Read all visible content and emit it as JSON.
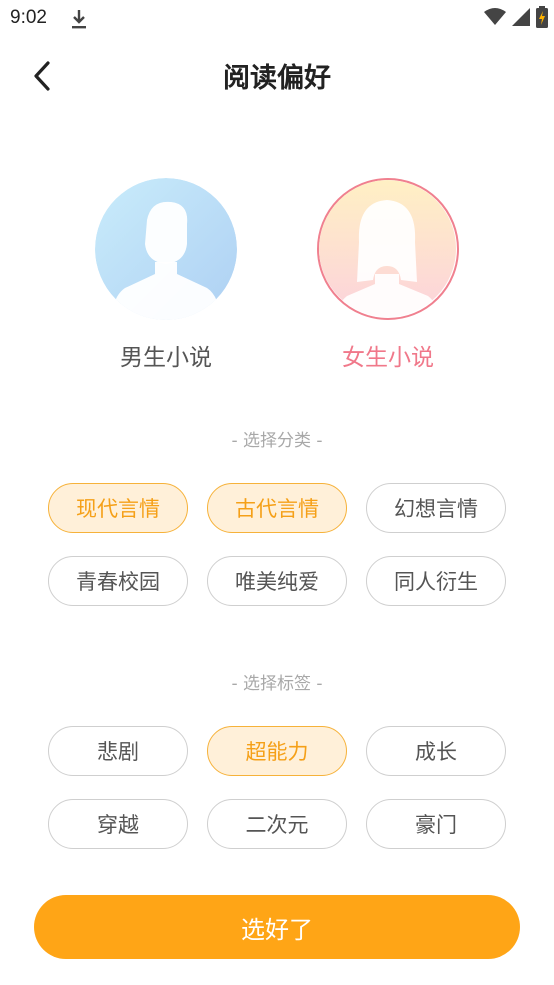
{
  "status_bar": {
    "time": "9:02"
  },
  "header": {
    "title": "阅读偏好"
  },
  "genders": [
    {
      "label": "男生小说",
      "selected": false
    },
    {
      "label": "女生小说",
      "selected": true
    }
  ],
  "category_section": {
    "title": "- 选择分类 -",
    "items": [
      {
        "label": "现代言情",
        "selected": true
      },
      {
        "label": "古代言情",
        "selected": true
      },
      {
        "label": "幻想言情",
        "selected": false
      },
      {
        "label": "青春校园",
        "selected": false
      },
      {
        "label": "唯美纯爱",
        "selected": false
      },
      {
        "label": "同人衍生",
        "selected": false
      }
    ]
  },
  "tag_section": {
    "title": "- 选择标签 -",
    "items": [
      {
        "label": "悲剧",
        "selected": false
      },
      {
        "label": "超能力",
        "selected": true
      },
      {
        "label": "成长",
        "selected": false
      },
      {
        "label": "穿越",
        "selected": false
      },
      {
        "label": "二次元",
        "selected": false
      },
      {
        "label": "豪门",
        "selected": false
      }
    ]
  },
  "submit_label": "选好了",
  "colors": {
    "accent": "#ffa516",
    "female_accent": "#f0788a",
    "chip_selected_bg": "#fff0d9"
  }
}
